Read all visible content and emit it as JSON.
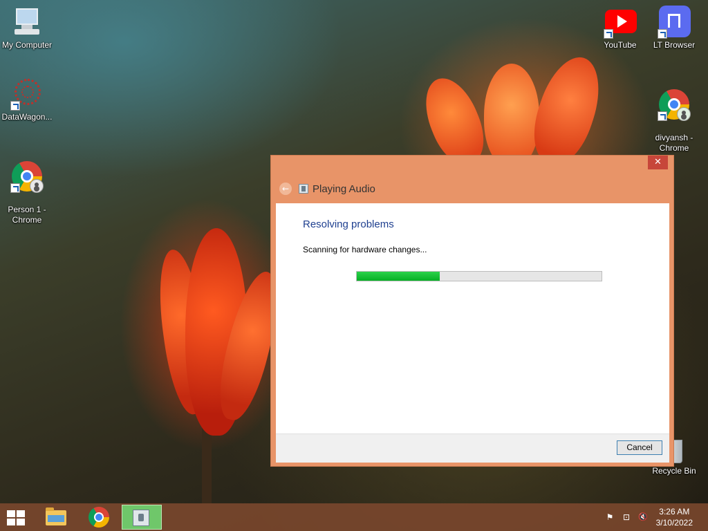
{
  "desktop": {
    "icons": [
      {
        "label": "My Computer"
      },
      {
        "label": "DataWagon..."
      },
      {
        "label": "Person 1 -\nChrome"
      },
      {
        "label": "YouTube"
      },
      {
        "label": "LT Browser"
      },
      {
        "label": "divyansh -\nChrome"
      },
      {
        "label": "Recycle Bin"
      }
    ]
  },
  "dialog": {
    "close_symbol": "✕",
    "back_symbol": "←",
    "title": "Playing Audio",
    "heading": "Resolving problems",
    "status": "Scanning for hardware changes...",
    "progress_fraction": 0.34,
    "progress_color": "#06b025",
    "cancel_label": "Cancel"
  },
  "taskbar": {
    "items": [
      {
        "icon": "windows-start-icon"
      },
      {
        "icon": "file-explorer-icon"
      },
      {
        "icon": "chrome-icon"
      },
      {
        "icon": "troubleshooter-icon",
        "active": true
      }
    ],
    "tray": {
      "flag_symbol": "⚑",
      "network_symbol": "⊡",
      "volume_symbol": "🔇"
    },
    "clock": {
      "time": "3:26 AM",
      "date": "3/10/2022"
    }
  },
  "colors": {
    "dialog_frame": "#e89468",
    "close_button": "#c7463a",
    "heading_blue": "#1e3f8f",
    "taskbar": "#78462d"
  }
}
